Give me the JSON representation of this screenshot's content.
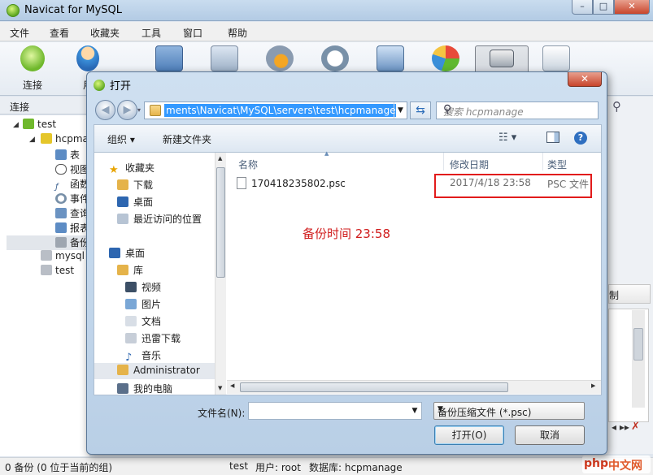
{
  "app": {
    "title": "Navicat for MySQL",
    "menu": [
      "文件",
      "查看",
      "收藏夹",
      "工具",
      "窗口",
      "帮助"
    ],
    "window_controls": {
      "minimize": "–",
      "maximize": "□",
      "close": "✕"
    }
  },
  "toolbar": {
    "connect_label": "连接",
    "user_label_partial": "用"
  },
  "connection_panel": {
    "header": "连接",
    "tree": [
      {
        "label": "test",
        "level": 0
      },
      {
        "label": "hcpmanage",
        "level": 1
      },
      {
        "label": "表",
        "level": 2
      },
      {
        "label": "视图",
        "level": 2
      },
      {
        "label": "函数",
        "level": 2
      },
      {
        "label": "事件",
        "level": 2
      },
      {
        "label": "查询",
        "level": 2
      },
      {
        "label": "报表",
        "level": 2
      },
      {
        "label": "备份",
        "level": 2
      },
      {
        "label": "mysql",
        "level": 1
      },
      {
        "label": "test",
        "level": 1
      }
    ]
  },
  "right_panel": {
    "partial_label": "制"
  },
  "status_bar": {
    "left": "0 备份 (0 位于当前的组)",
    "connection": "test",
    "user": "用户: root",
    "database": "数据库: hcpmanage"
  },
  "watermark": {
    "text": "php",
    "suffix": "中文网"
  },
  "dialog": {
    "title": "打开",
    "address_path": "ments\\Navicat\\MySQL\\servers\\test\\hcpmanage",
    "search_placeholder": "搜索 hcpmanage",
    "organize_label": "组织 ▾",
    "new_folder_label": "新建文件夹",
    "nav": [
      {
        "label": "收藏夹",
        "group": true
      },
      {
        "label": "下载"
      },
      {
        "label": "桌面"
      },
      {
        "label": "最近访问的位置"
      },
      {
        "label": "桌面",
        "group": true
      },
      {
        "label": "库"
      },
      {
        "label": "视频"
      },
      {
        "label": "图片"
      },
      {
        "label": "文档"
      },
      {
        "label": "迅雷下载"
      },
      {
        "label": "音乐"
      },
      {
        "label": "Administrator"
      },
      {
        "label": "我的电脑"
      }
    ],
    "columns": {
      "name": "名称",
      "modified": "修改日期",
      "type": "类型"
    },
    "files": [
      {
        "name": "170418235802.psc",
        "modified": "2017/4/18 23:58",
        "type": "PSC 文件"
      }
    ],
    "annotation": "备份时间   23:58",
    "filename_label": "文件名(N):",
    "filename_value": "",
    "filetype_value": "备份压缩文件 (*.psc)",
    "open_button": "打开(O)",
    "cancel_button": "取消"
  },
  "colors": {
    "selection_blue": "#3399ff",
    "annotation_red": "#e21b1b",
    "title_bar": "#c9dcef"
  }
}
